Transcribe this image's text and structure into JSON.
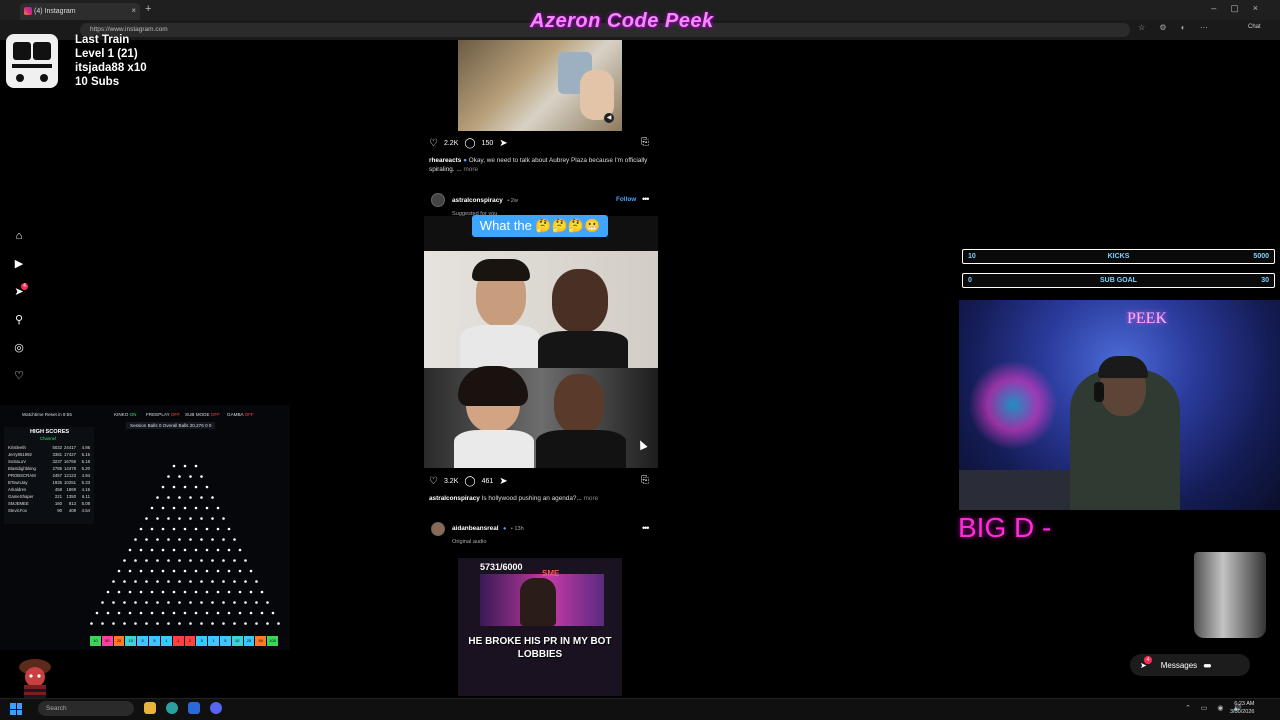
{
  "browser": {
    "tab_title": "(4) Instagram",
    "new_tab": "+",
    "tab_close": "×",
    "url": "https://www.instagram.com",
    "chat_label": "Chat",
    "window_controls": "–▢×"
  },
  "overlay": {
    "title": "Azeron Code Peek",
    "train": {
      "name": "Last Train",
      "level": "Level 1  (21)",
      "user": "itsjada88 x10",
      "subs": "10 Subs"
    },
    "kicks_goal": {
      "current": "10",
      "label": "KICKS",
      "target": "5000"
    },
    "sub_goal": {
      "current": "0",
      "label": "SUB GOAL",
      "target": "30"
    },
    "cam_sign": "PEEK",
    "big_text": "BIG D -"
  },
  "instagram": {
    "nav_icons": [
      "home-icon",
      "reels-icon",
      "direct-icon",
      "search-icon",
      "explore-icon",
      "notifications-icon"
    ],
    "nav_badge": "4",
    "post1": {
      "likes": "2.2K",
      "comments": "150",
      "username": "rheareacts",
      "caption": "Okay, we need to talk about Aubrey Plaza because I'm officially spiraling. ...",
      "more": "more"
    },
    "post2": {
      "username": "astralconspiracy",
      "time": "• 2w",
      "subtitle": "Suggested for you",
      "follow": "Follow",
      "overlay_text": "What the 🤔🤔🤔😬",
      "likes": "3.2K",
      "comments": "461",
      "caption_user": "astralconspiracy",
      "caption": "Is hollywood pushing an agenda?...",
      "more": "more"
    },
    "post3": {
      "username": "aidanbeansreal",
      "time": "• 13h",
      "subtitle": "Original audio",
      "counter": "5731/6000",
      "logo": "SME",
      "caption": "HE BROKE HIS PR IN MY BOT LOBBIES"
    },
    "messages": {
      "label": "Messages",
      "badge": "4"
    }
  },
  "plinko": {
    "status": "Watchtime Reset in 9:55",
    "toggles": [
      {
        "label": "KINKO",
        "state": "ON"
      },
      {
        "label": "FREEPLAY",
        "state": "OFF"
      },
      {
        "label": "SUB MODE",
        "state": "OFF"
      },
      {
        "label": "GAMBA",
        "state": "OFF"
      }
    ],
    "session": "Session Balls   0      Overall Balls   20,276     0   0",
    "high_scores_title": "HIGH SCORES",
    "high_scores_channel": "Channel",
    "high_scores": [
      {
        "name": "Kristleeth",
        "a": "5032",
        "b": "24417",
        "c": "4.86"
      },
      {
        "name": "Jerry851992",
        "a": "3381",
        "b": "17427",
        "c": "5.15"
      },
      {
        "name": "SoSaLuV",
        "a": "3237",
        "b": "16766",
        "c": "5.18"
      },
      {
        "name": "Blastdighbking",
        "a": "2785",
        "b": "14478",
        "c": "5.20"
      },
      {
        "name": "PROBSCRAM",
        "a": "2457",
        "b": "12123",
        "c": "4.94"
      },
      {
        "name": "BTownJay",
        "a": "1935",
        "b": "10251",
        "c": "5.33"
      },
      {
        "name": "Arkaldres",
        "a": "458",
        "b": "1869",
        "c": "4.15"
      },
      {
        "name": "GameShaper",
        "a": "221",
        "b": "1350",
        "c": "6.11"
      },
      {
        "name": "SMJEMEE",
        "a": "160",
        "b": "813",
        "c": "5.08"
      },
      {
        "name": "StevicFox",
        "a": "90",
        "b": "409",
        "c": "4.54"
      }
    ],
    "slots": [
      "10",
      "50",
      "25",
      "10",
      "5",
      "5",
      "1",
      "-1",
      "2",
      "5",
      "1",
      "5",
      "10",
      "25",
      "50",
      "100"
    ],
    "slot_colors": [
      "#3cd55a",
      "#ff3fa0",
      "#ff7a2a",
      "#3cd5d5",
      "#3cc8ff",
      "#3cc8ff",
      "#3cc8ff",
      "#ff4040",
      "#ff4040",
      "#3cc8ff",
      "#3cc8ff",
      "#3cc8ff",
      "#3cd5d5",
      "#3cc8ff",
      "#ff7a2a",
      "#3cd55a"
    ]
  },
  "taskbar": {
    "search_placeholder": "Search",
    "time": "6:23 AM",
    "date": "3/30/2026"
  }
}
